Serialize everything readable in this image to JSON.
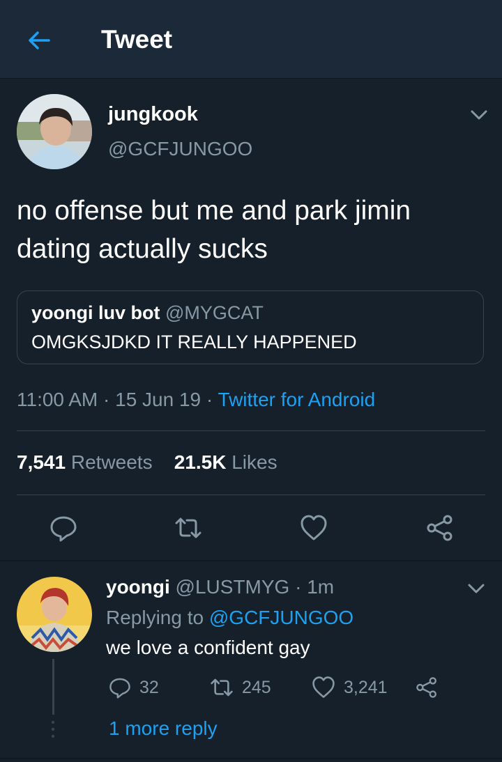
{
  "header": {
    "title": "Tweet"
  },
  "tweet": {
    "name": "jungkook",
    "handle": "@GCFJUNGOO",
    "text": "no offense but me and park jimin dating actually sucks",
    "quote": {
      "name": "yoongi luv bot",
      "handle": "@MYGCAT",
      "text": "OMGKSJDKD IT REALLY HAPPENED"
    },
    "time": "11:00 AM",
    "date": "15 Jun 19",
    "source": "Twitter for Android",
    "retweets_count": "7,541",
    "retweets_label": "Retweets",
    "likes_count": "21.5K",
    "likes_label": "Likes"
  },
  "reply": {
    "name": "yoongi",
    "handle": "@LUSTMYG",
    "age": "1m",
    "replying_prefix": "Replying to",
    "replying_to": "@GCFJUNGOO",
    "text": "we love a confident gay",
    "reply_count": "32",
    "retweet_count": "245",
    "like_count": "3,241",
    "more_replies": "1 more reply"
  },
  "colors": {
    "background": "#15202b",
    "header_bg": "#1c2938",
    "accent": "#1da1f2",
    "muted": "#8899a6"
  },
  "icons": [
    "back-arrow-icon",
    "chevron-down-icon",
    "reply-icon",
    "retweet-icon",
    "like-icon",
    "share-icon"
  ]
}
